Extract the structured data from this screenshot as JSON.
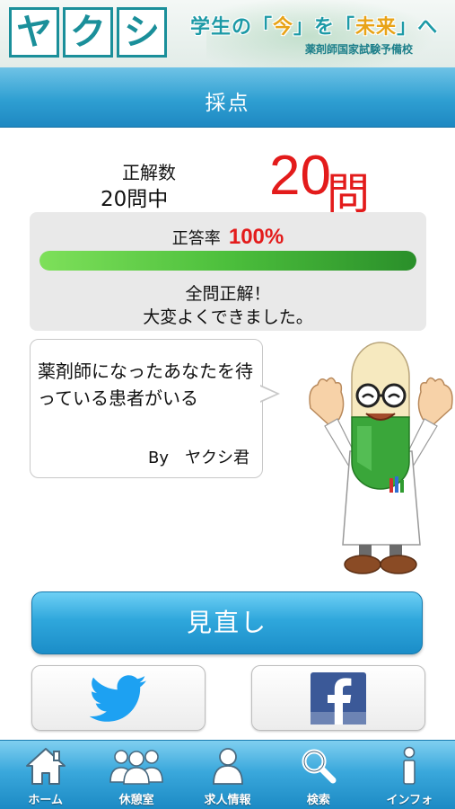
{
  "banner": {
    "logo": [
      "ヤ",
      "ク",
      "シ"
    ],
    "tagline_prefix": "学生の「",
    "tagline_now": "今",
    "tagline_mid": "」を「",
    "tagline_future": "未来",
    "tagline_suffix": "」へ",
    "subtitle": "薬剤師国家試験予備校"
  },
  "header": {
    "title": "採点"
  },
  "score": {
    "label": "正解数",
    "total": "20問中",
    "value": "20",
    "unit": "問"
  },
  "result": {
    "rate_label": "正答率",
    "rate_value": "100%",
    "rate_fraction": 1.0,
    "line1": "全問正解！",
    "line2": "大変よくできました。"
  },
  "bubble": {
    "message": "薬剤師になったあなたを待っている患者がいる",
    "signature": "By　ヤクシ君"
  },
  "buttons": {
    "review": "見直し",
    "share_twitter_icon": "twitter-bird-icon",
    "share_facebook_icon": "facebook-icon"
  },
  "tabbar": {
    "items": [
      {
        "label": "ホーム",
        "icon": "home-icon"
      },
      {
        "label": "休憩室",
        "icon": "people-icon"
      },
      {
        "label": "求人情報",
        "icon": "person-icon"
      },
      {
        "label": "検索",
        "icon": "search-icon"
      },
      {
        "label": "インフォ",
        "icon": "info-icon"
      }
    ]
  },
  "colors": {
    "accent_blue": "#2f9fd2",
    "score_red": "#e31b1b",
    "bar_green": "#4cbf3c",
    "twitter_blue": "#1da1f2",
    "facebook_blue": "#3b5998"
  }
}
